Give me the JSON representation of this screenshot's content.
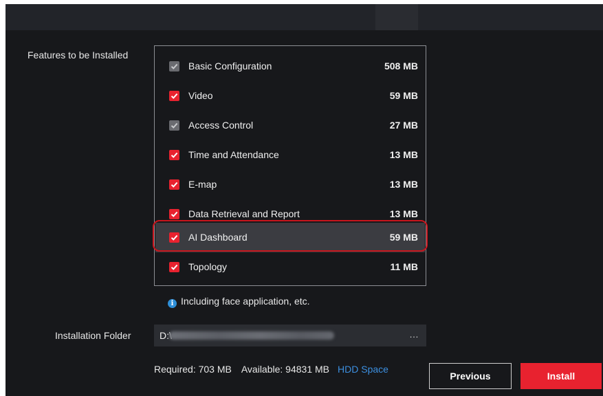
{
  "labels": {
    "features": "Features to be Installed",
    "folder": "Installation Folder"
  },
  "features": [
    {
      "name": "Basic Configuration",
      "size": "508 MB",
      "checked": true,
      "locked": true
    },
    {
      "name": "Video",
      "size": "59 MB",
      "checked": true,
      "locked": false
    },
    {
      "name": "Access Control",
      "size": "27 MB",
      "checked": true,
      "locked": true
    },
    {
      "name": "Time and Attendance",
      "size": "13 MB",
      "checked": true,
      "locked": false
    },
    {
      "name": "E-map",
      "size": "13 MB",
      "checked": true,
      "locked": false
    },
    {
      "name": "Data Retrieval and Report",
      "size": "13 MB",
      "checked": true,
      "locked": false
    },
    {
      "name": "AI Dashboard",
      "size": "59 MB",
      "checked": true,
      "locked": false,
      "highlighted": true
    },
    {
      "name": "Topology",
      "size": "11 MB",
      "checked": true,
      "locked": false
    }
  ],
  "info": {
    "icon": "info-icon",
    "text": "Including face application, etc."
  },
  "folder": {
    "value_prefix": "D:\\",
    "browse_label": "…"
  },
  "space": {
    "required": "Required: 703 MB",
    "available": "Available: 94831 MB",
    "hdd_link": "HDD Space"
  },
  "buttons": {
    "previous": "Previous",
    "install": "Install"
  },
  "colors": {
    "accent": "#e8222f",
    "background": "#17181b",
    "link": "#3c8fe0",
    "annotation": "#c8151d"
  }
}
